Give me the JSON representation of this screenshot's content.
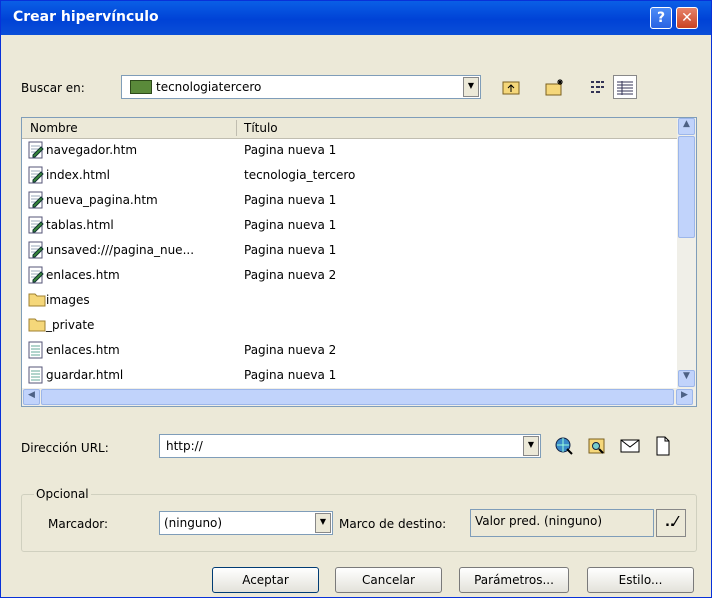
{
  "window": {
    "title": "Crear hipervínculo",
    "help_glyph": "?",
    "close_glyph": "✕"
  },
  "search": {
    "label": "Buscar en:",
    "folder": "tecnologiatercero",
    "folder_icon": "folder-icon"
  },
  "toolbar": [
    "up-folder-icon",
    "new-folder-icon",
    "list-view-icon",
    "details-view-icon"
  ],
  "columns": {
    "name": "Nombre",
    "title": "Título"
  },
  "files": [
    {
      "name": "navegador.htm",
      "title": "Pagina nueva 1",
      "icon": "html-page-edit-icon"
    },
    {
      "name": "index.html",
      "title": "tecnologia_tercero",
      "icon": "html-page-edit-icon"
    },
    {
      "name": "nueva_pagina.htm",
      "title": "Pagina nueva 1",
      "icon": "html-page-edit-icon"
    },
    {
      "name": "tablas.html",
      "title": "Pagina nueva 1",
      "icon": "html-page-edit-icon"
    },
    {
      "name": "unsaved:///pagina_nue...",
      "title": "Pagina nueva 1",
      "icon": "html-page-edit-icon"
    },
    {
      "name": "enlaces.htm",
      "title": "Pagina nueva 2",
      "icon": "html-page-edit-icon"
    },
    {
      "name": "images",
      "title": "",
      "icon": "folder-icon"
    },
    {
      "name": "_private",
      "title": "",
      "icon": "folder-icon"
    },
    {
      "name": "enlaces.htm",
      "title": "Pagina nueva 2",
      "icon": "html-page-icon"
    },
    {
      "name": "guardar.html",
      "title": "Pagina nueva 1",
      "icon": "html-page-icon"
    }
  ],
  "url": {
    "label": "Dirección URL:",
    "value": "http://"
  },
  "url_tools": [
    "browse-web-icon",
    "browse-file-icon",
    "email-icon",
    "new-document-icon"
  ],
  "optional": {
    "legend": "Opcional",
    "bookmark_label": "Marcador:",
    "bookmark_value": "(ninguno)",
    "target_label": "Marco de destino:",
    "target_value": "Valor pred. (ninguno)"
  },
  "buttons": {
    "accept": "Aceptar",
    "cancel": "Cancelar",
    "params": "Parámetros...",
    "style": "Estilo..."
  }
}
